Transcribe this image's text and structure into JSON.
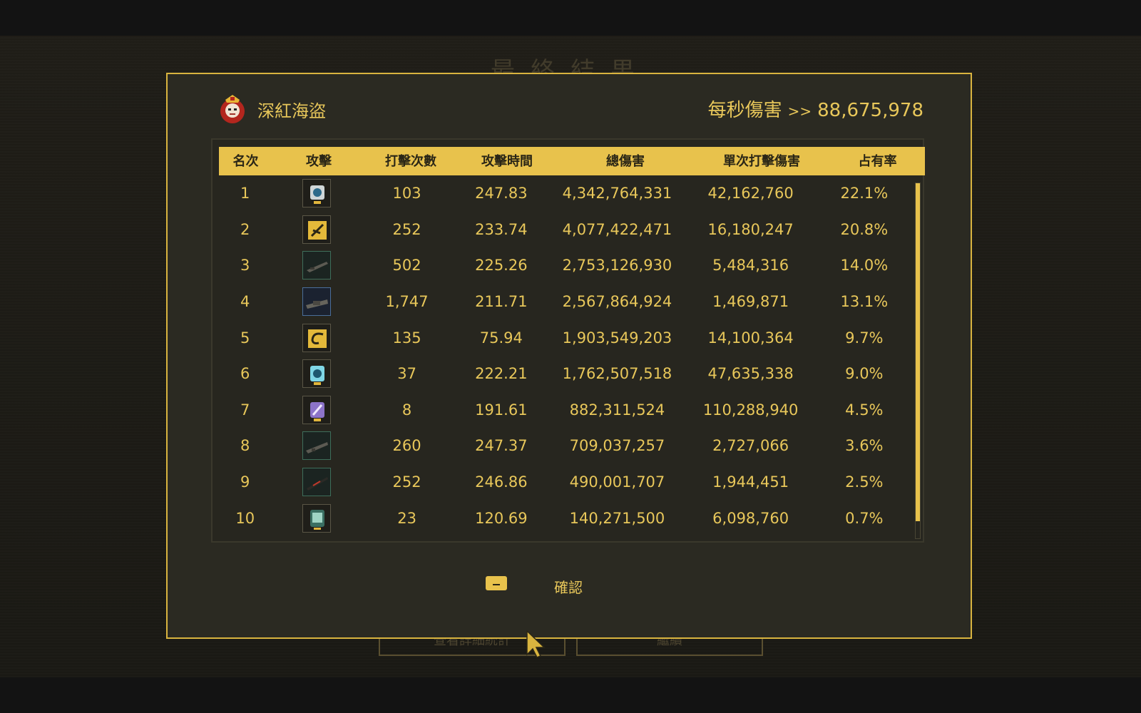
{
  "background": {
    "title": "最終結果",
    "buttons": [
      "查看詳細統計",
      "繼續"
    ]
  },
  "boss": {
    "name": "深紅海盜",
    "icon": "crimson-pirate-avatar"
  },
  "dps": {
    "label": "每秒傷害",
    "arrows": ">>",
    "value": "88,675,978"
  },
  "table": {
    "headers": [
      "名次",
      "攻擊",
      "打擊次數",
      "攻擊時間",
      "總傷害",
      "單次打擊傷害",
      "占有率"
    ],
    "rows": [
      {
        "rank": "1",
        "icon": "blue-skill-icon",
        "hits": "103",
        "time": "247.83",
        "total": "4,342,764,331",
        "per_hit": "42,162,760",
        "share": "22.1%"
      },
      {
        "rank": "2",
        "icon": "gold-slash-skill-icon",
        "hits": "252",
        "time": "233.74",
        "total": "4,077,422,471",
        "per_hit": "16,180,247",
        "share": "20.8%"
      },
      {
        "rank": "3",
        "icon": "rifle-weapon-icon",
        "hits": "502",
        "time": "225.26",
        "total": "2,753,126,930",
        "per_hit": "5,484,316",
        "share": "14.0%"
      },
      {
        "rank": "4",
        "icon": "heavy-gun-weapon-icon",
        "hits": "1,747",
        "time": "211.71",
        "total": "2,567,864,924",
        "per_hit": "1,469,871",
        "share": "13.1%"
      },
      {
        "rank": "5",
        "icon": "gold-spiral-skill-icon",
        "hits": "135",
        "time": "75.94",
        "total": "1,903,549,203",
        "per_hit": "14,100,364",
        "share": "9.7%"
      },
      {
        "rank": "6",
        "icon": "cyan-skill-icon",
        "hits": "37",
        "time": "222.21",
        "total": "1,762,507,518",
        "per_hit": "47,635,338",
        "share": "9.0%"
      },
      {
        "rank": "7",
        "icon": "purple-skill-icon",
        "hits": "8",
        "time": "191.61",
        "total": "882,311,524",
        "per_hit": "110,288,940",
        "share": "4.5%"
      },
      {
        "rank": "8",
        "icon": "shotgun-weapon-icon",
        "hits": "260",
        "time": "247.37",
        "total": "709,037,257",
        "per_hit": "2,727,066",
        "share": "3.6%"
      },
      {
        "rank": "9",
        "icon": "red-rifle-weapon-icon",
        "hits": "252",
        "time": "246.86",
        "total": "490,001,707",
        "per_hit": "1,944,451",
        "share": "2.5%"
      },
      {
        "rank": "10",
        "icon": "green-device-icon",
        "hits": "23",
        "time": "120.69",
        "total": "140,271,500",
        "per_hit": "6,098,760",
        "share": "0.7%"
      }
    ]
  },
  "confirm": {
    "key_icon": "key-icon",
    "label": "確認"
  },
  "colors": {
    "accent": "#e8c24c",
    "text": "#e8c75a",
    "panel": "#2b2a22"
  }
}
